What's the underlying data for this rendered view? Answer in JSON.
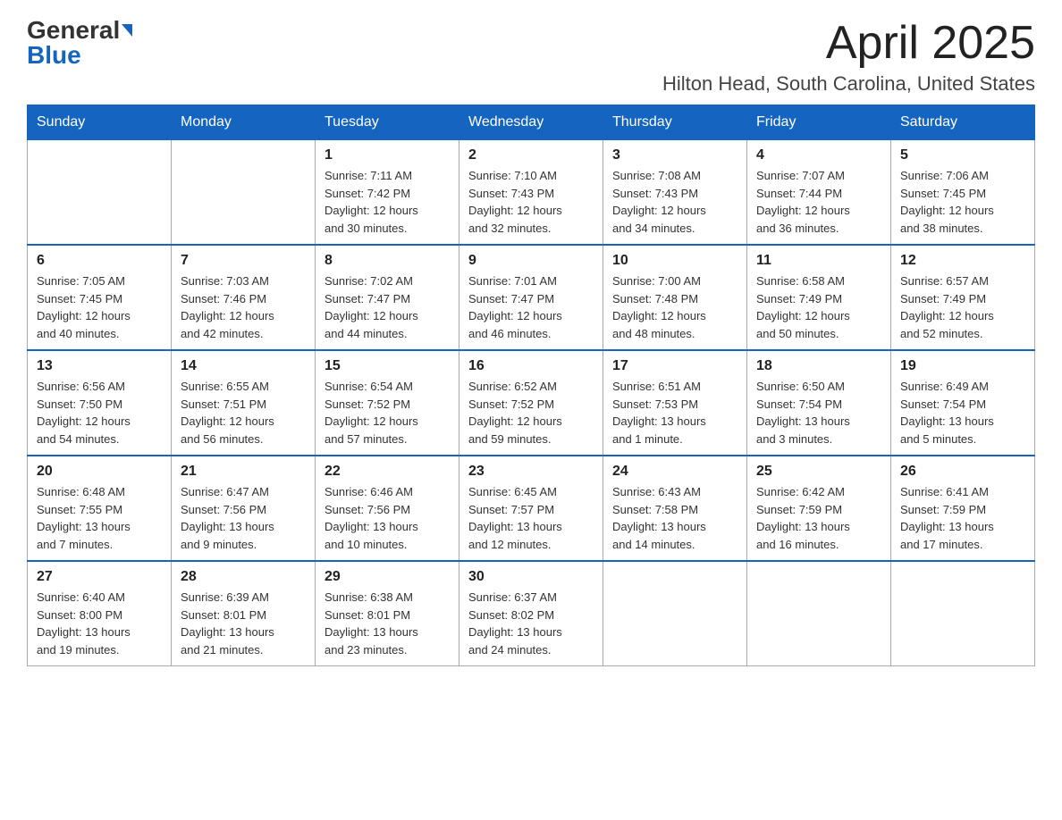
{
  "logo": {
    "general": "General",
    "blue": "Blue"
  },
  "title": {
    "month": "April 2025",
    "location": "Hilton Head, South Carolina, United States"
  },
  "weekdays": [
    "Sunday",
    "Monday",
    "Tuesday",
    "Wednesday",
    "Thursday",
    "Friday",
    "Saturday"
  ],
  "weeks": [
    [
      {
        "day": "",
        "info": ""
      },
      {
        "day": "",
        "info": ""
      },
      {
        "day": "1",
        "info": "Sunrise: 7:11 AM\nSunset: 7:42 PM\nDaylight: 12 hours\nand 30 minutes."
      },
      {
        "day": "2",
        "info": "Sunrise: 7:10 AM\nSunset: 7:43 PM\nDaylight: 12 hours\nand 32 minutes."
      },
      {
        "day": "3",
        "info": "Sunrise: 7:08 AM\nSunset: 7:43 PM\nDaylight: 12 hours\nand 34 minutes."
      },
      {
        "day": "4",
        "info": "Sunrise: 7:07 AM\nSunset: 7:44 PM\nDaylight: 12 hours\nand 36 minutes."
      },
      {
        "day": "5",
        "info": "Sunrise: 7:06 AM\nSunset: 7:45 PM\nDaylight: 12 hours\nand 38 minutes."
      }
    ],
    [
      {
        "day": "6",
        "info": "Sunrise: 7:05 AM\nSunset: 7:45 PM\nDaylight: 12 hours\nand 40 minutes."
      },
      {
        "day": "7",
        "info": "Sunrise: 7:03 AM\nSunset: 7:46 PM\nDaylight: 12 hours\nand 42 minutes."
      },
      {
        "day": "8",
        "info": "Sunrise: 7:02 AM\nSunset: 7:47 PM\nDaylight: 12 hours\nand 44 minutes."
      },
      {
        "day": "9",
        "info": "Sunrise: 7:01 AM\nSunset: 7:47 PM\nDaylight: 12 hours\nand 46 minutes."
      },
      {
        "day": "10",
        "info": "Sunrise: 7:00 AM\nSunset: 7:48 PM\nDaylight: 12 hours\nand 48 minutes."
      },
      {
        "day": "11",
        "info": "Sunrise: 6:58 AM\nSunset: 7:49 PM\nDaylight: 12 hours\nand 50 minutes."
      },
      {
        "day": "12",
        "info": "Sunrise: 6:57 AM\nSunset: 7:49 PM\nDaylight: 12 hours\nand 52 minutes."
      }
    ],
    [
      {
        "day": "13",
        "info": "Sunrise: 6:56 AM\nSunset: 7:50 PM\nDaylight: 12 hours\nand 54 minutes."
      },
      {
        "day": "14",
        "info": "Sunrise: 6:55 AM\nSunset: 7:51 PM\nDaylight: 12 hours\nand 56 minutes."
      },
      {
        "day": "15",
        "info": "Sunrise: 6:54 AM\nSunset: 7:52 PM\nDaylight: 12 hours\nand 57 minutes."
      },
      {
        "day": "16",
        "info": "Sunrise: 6:52 AM\nSunset: 7:52 PM\nDaylight: 12 hours\nand 59 minutes."
      },
      {
        "day": "17",
        "info": "Sunrise: 6:51 AM\nSunset: 7:53 PM\nDaylight: 13 hours\nand 1 minute."
      },
      {
        "day": "18",
        "info": "Sunrise: 6:50 AM\nSunset: 7:54 PM\nDaylight: 13 hours\nand 3 minutes."
      },
      {
        "day": "19",
        "info": "Sunrise: 6:49 AM\nSunset: 7:54 PM\nDaylight: 13 hours\nand 5 minutes."
      }
    ],
    [
      {
        "day": "20",
        "info": "Sunrise: 6:48 AM\nSunset: 7:55 PM\nDaylight: 13 hours\nand 7 minutes."
      },
      {
        "day": "21",
        "info": "Sunrise: 6:47 AM\nSunset: 7:56 PM\nDaylight: 13 hours\nand 9 minutes."
      },
      {
        "day": "22",
        "info": "Sunrise: 6:46 AM\nSunset: 7:56 PM\nDaylight: 13 hours\nand 10 minutes."
      },
      {
        "day": "23",
        "info": "Sunrise: 6:45 AM\nSunset: 7:57 PM\nDaylight: 13 hours\nand 12 minutes."
      },
      {
        "day": "24",
        "info": "Sunrise: 6:43 AM\nSunset: 7:58 PM\nDaylight: 13 hours\nand 14 minutes."
      },
      {
        "day": "25",
        "info": "Sunrise: 6:42 AM\nSunset: 7:59 PM\nDaylight: 13 hours\nand 16 minutes."
      },
      {
        "day": "26",
        "info": "Sunrise: 6:41 AM\nSunset: 7:59 PM\nDaylight: 13 hours\nand 17 minutes."
      }
    ],
    [
      {
        "day": "27",
        "info": "Sunrise: 6:40 AM\nSunset: 8:00 PM\nDaylight: 13 hours\nand 19 minutes."
      },
      {
        "day": "28",
        "info": "Sunrise: 6:39 AM\nSunset: 8:01 PM\nDaylight: 13 hours\nand 21 minutes."
      },
      {
        "day": "29",
        "info": "Sunrise: 6:38 AM\nSunset: 8:01 PM\nDaylight: 13 hours\nand 23 minutes."
      },
      {
        "day": "30",
        "info": "Sunrise: 6:37 AM\nSunset: 8:02 PM\nDaylight: 13 hours\nand 24 minutes."
      },
      {
        "day": "",
        "info": ""
      },
      {
        "day": "",
        "info": ""
      },
      {
        "day": "",
        "info": ""
      }
    ]
  ]
}
